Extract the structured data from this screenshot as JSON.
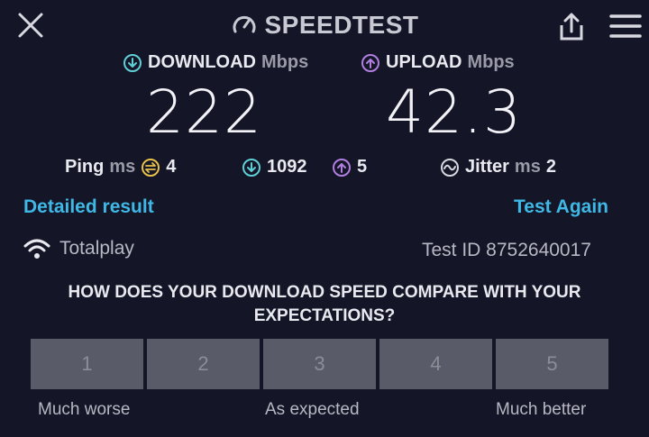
{
  "header": {
    "brand": "SPEEDTEST",
    "close_icon": "close-icon",
    "share_icon": "share-icon",
    "menu_icon": "menu-icon"
  },
  "download": {
    "label": "DOWNLOAD",
    "unit": "Mbps",
    "value": "222",
    "icon": "download-arrow-icon"
  },
  "upload": {
    "label": "UPLOAD",
    "unit": "Mbps",
    "value": "42.3",
    "icon": "upload-arrow-icon"
  },
  "stats": {
    "ping_label": "Ping",
    "ping_unit": "ms",
    "ping_value": "4",
    "download_latency": "1092",
    "upload_latency": "5",
    "jitter_label": "Jitter",
    "jitter_unit": "ms",
    "jitter_value": "2"
  },
  "links": {
    "detailed": "Detailed result",
    "again": "Test Again"
  },
  "provider": {
    "name": "Totalplay",
    "test_id": "Test ID 8752640017"
  },
  "survey": {
    "question": "HOW DOES YOUR DOWNLOAD SPEED COMPARE WITH YOUR EXPECTATIONS?",
    "options": [
      "1",
      "2",
      "3",
      "4",
      "5"
    ],
    "scale_left": "Much worse",
    "scale_mid": "As expected",
    "scale_right": "Much better"
  },
  "colors": {
    "background": "#141527",
    "download_accent": "#5fd0d6",
    "upload_accent": "#b07fe0",
    "link": "#3fb8e6",
    "ping_accent": "#e8c04a"
  }
}
